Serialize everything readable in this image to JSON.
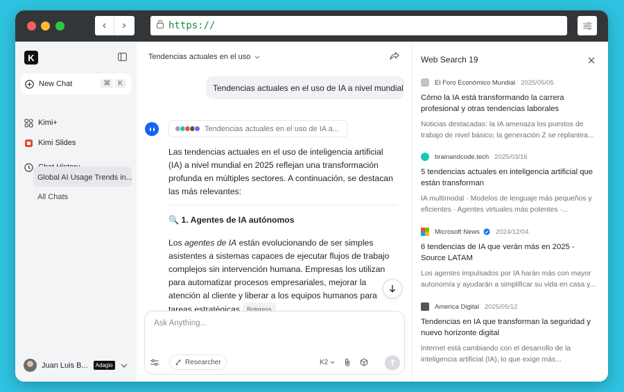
{
  "browser": {
    "url": "https://"
  },
  "sidebar": {
    "logo": "K",
    "new_chat": "New Chat",
    "shortcut": [
      "⌘",
      "K"
    ],
    "items": [
      {
        "label": "Kimi+"
      },
      {
        "label": "Kimi Slides"
      }
    ],
    "history_label": "Chat History",
    "history_active": "Global AI Usage Trends in...",
    "all_chats": "All Chats",
    "user_name": "Juan Luis B...",
    "user_badge": "Adagio"
  },
  "chat": {
    "title": "Tendencias actuales en el uso",
    "user_message": "Tendencias actuales en el uso de IA a nivel mundial",
    "sources_pill": "Tendencias actuales en el uso de IA a...",
    "intro": "Las tendencias actuales en el uso de inteligencia artificial (IA) a nivel mundial en 2025 reflejan una transformación profunda en múltiples sectores. A continuación, se destacan las más relevantes:",
    "section_heading": "🔍 1. Agentes de IA autónomos",
    "body_before": "Los ",
    "body_em": "agentes de IA",
    "body_after": " están evolucionando de ser simples asistentes a sistemas capaces de ejecutar flujos de trabajo complejos sin intervención humana. Empresas los utilizan para automatizar procesos empresariales, mejorar la atención al cliente y liberar a los equipos humanos para tareas estratégicas",
    "citation": "Botpress",
    "body_end": " ."
  },
  "input": {
    "placeholder": "Ask Anything...",
    "researcher": "Researcher",
    "model": "K2"
  },
  "panel": {
    "title": "Web Search 19",
    "results": [
      {
        "source": "El Foro Económico Mundial",
        "date": "2025/05/05",
        "title": "Cómo la IA está transformando la carrera profesional y otras tendencias laborales",
        "snippet": "Noticias destacadas: la IA amenaza los puestos de trabajo de nivel básico; la generación Z se replantea...",
        "color": "#9aa0a6"
      },
      {
        "source": "brainandcode.tech",
        "date": "2025/03/16",
        "title": "5 tendencias actuales en inteligencia artificial que están transforman",
        "snippet": "IA multimodal · Modelos de lenguaje más pequeños y eficientes · Agentes virtuales más potentes ·...",
        "color": "#18c9b6"
      },
      {
        "source": "Microsoft News",
        "date": "2024/12/04",
        "title": "6 tendencias de IA que verán más en 2025 - Source LATAM",
        "snippet": "Los agentes impulsados por IA harán más con mayor autonomía y ayudarán a simplificar su vida en casa y...",
        "color": "#f25022"
      },
      {
        "source": "America Digital",
        "date": "2025/05/12",
        "title": "Tendencias en IA que transforman la seguridad y nuevo horizonte digital",
        "snippet": "Internet está cambiando con el desarrollo de la inteligencia artificial (IA), lo que exige más...",
        "color": "#555555"
      }
    ]
  },
  "colors": {
    "background": "#2ec3e0",
    "accent": "#1663f5",
    "titlebar": "#333638"
  }
}
